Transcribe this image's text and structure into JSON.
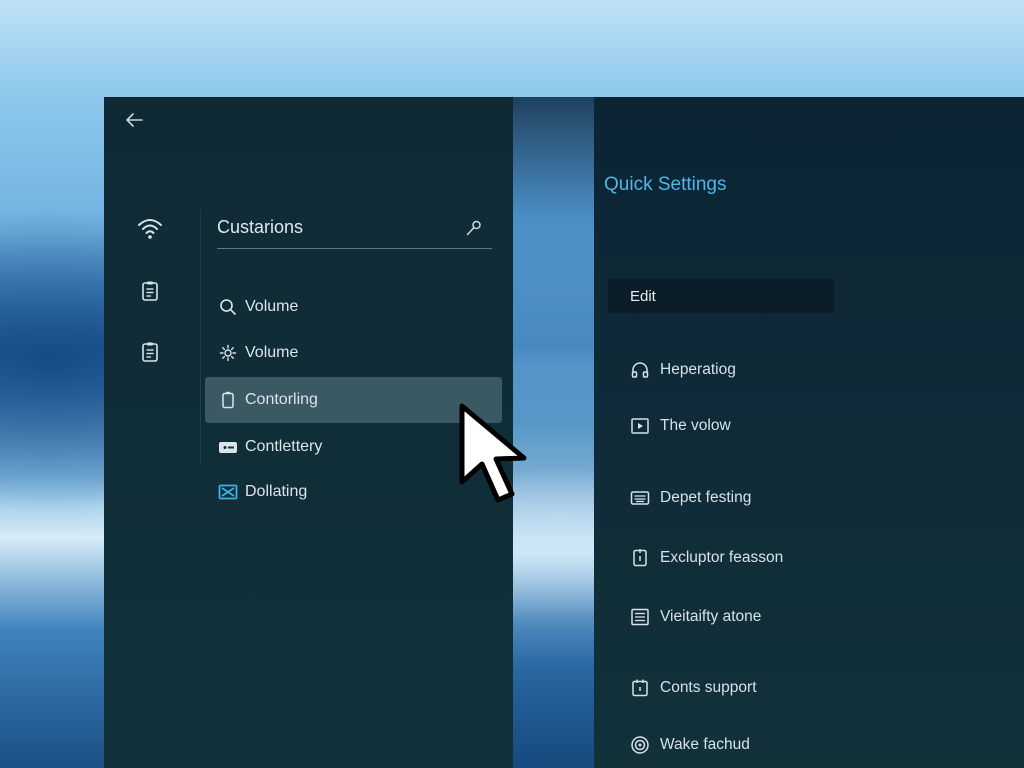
{
  "sidebar": {
    "search_title": "Custarions",
    "items": [
      {
        "label": "Volume",
        "icon": "search-icon"
      },
      {
        "label": "Volume",
        "icon": "settings-icon"
      },
      {
        "label": "Contorling",
        "icon": "battery-icon",
        "selected": true
      },
      {
        "label": "Contlettery",
        "icon": "card-icon"
      },
      {
        "label": "Dollating",
        "icon": "display-icon"
      }
    ],
    "rail_icons": [
      "wifi-icon",
      "clipboard-icon",
      "clipboard-icon"
    ]
  },
  "quick_settings": {
    "title": "Quick Settings",
    "edit_label": "Edit",
    "items": [
      {
        "label": "Heperatiog",
        "icon": "headphones-icon"
      },
      {
        "label": "The volow",
        "icon": "play-icon"
      },
      {
        "label": "Depet festing",
        "icon": "keyboard-icon"
      },
      {
        "label": "Excluptor feasson",
        "icon": "document-icon"
      },
      {
        "label": "Vieitaifty atone",
        "icon": "list-icon"
      },
      {
        "label": "Conts support",
        "icon": "calendar-icon"
      },
      {
        "label": "Wake fachud",
        "icon": "target-icon"
      }
    ]
  },
  "colors": {
    "accent": "#4fb6e6",
    "panel": "#102d37",
    "selected": "#4a6269"
  }
}
